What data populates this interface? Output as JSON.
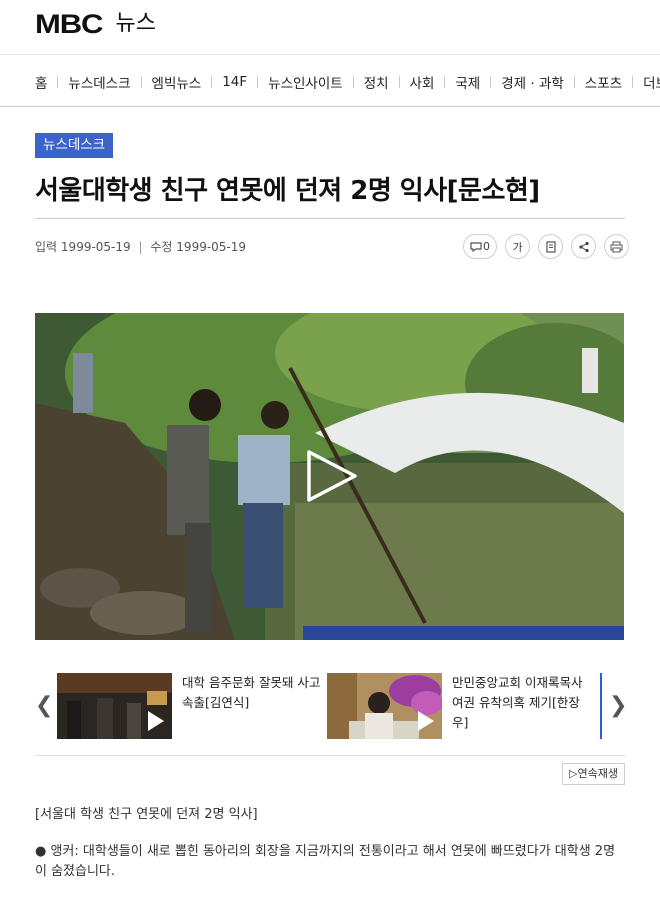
{
  "header": {
    "logo_mark": "MBC",
    "logo_text": "뉴스"
  },
  "nav": {
    "items": [
      "홈",
      "뉴스데스크",
      "엠빅뉴스",
      "14F",
      "뉴스인사이트",
      "정치",
      "사회",
      "국제",
      "경제 · 과학",
      "스포츠",
      "더보기"
    ]
  },
  "article": {
    "category": "뉴스데스크",
    "title": "서울대학생 친구 연못에 던져 2명 익사[문소현]",
    "input_label": "입력",
    "input_date": "1999-05-19",
    "modified_label": "수정",
    "modified_date": "1999-05-19",
    "comment_count": "0",
    "font_size_label": "가",
    "subtitle": "[서울대 학생 친구 연못에 던져 2명 익사]",
    "body": "● 앵커: 대학생들이 새로 뽑힌 동아리의 회장을 지금까지의 전통이라고 해서 연못에 빠뜨렸다가 대학생 2명이 숨졌습니다."
  },
  "tools": {
    "icons": [
      "comment-icon",
      "font-size-icon",
      "bookmark-icon",
      "share-icon",
      "print-icon"
    ]
  },
  "related": {
    "items": [
      {
        "title": "대학 음주문화 잘못돼 사고속출[김연식]"
      },
      {
        "title": "만민중앙교회 이재록목사 여권 유착의혹 제기[한장우]"
      }
    ],
    "autoplay_label": "▷연속재생"
  },
  "colors": {
    "badge": "#3b63c9",
    "accent_line": "#2d5ad7"
  }
}
